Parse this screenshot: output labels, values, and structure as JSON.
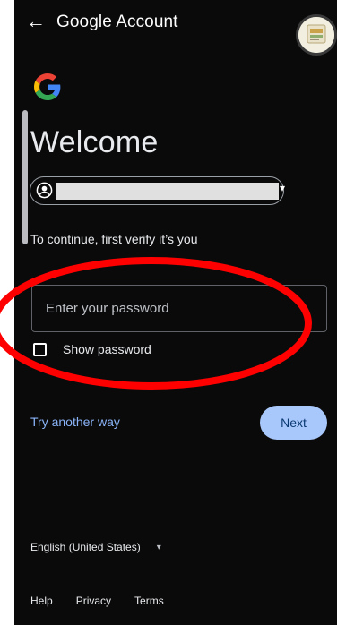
{
  "header": {
    "title_brand": "Google",
    "title_rest": " Account",
    "back_icon": "arrow-left-icon"
  },
  "main": {
    "heading": "Welcome",
    "verify_text": "To continue, first verify it’s you",
    "password_placeholder": "Enter your password",
    "show_password_label": "Show password",
    "show_password_checked": false,
    "try_another_way": "Try another way",
    "next_button": "Next"
  },
  "footer": {
    "language": "English (United States)",
    "links": [
      "Help",
      "Privacy",
      "Terms"
    ]
  },
  "colors": {
    "background": "#0a0a0a",
    "link": "#8ab4f8",
    "primary_button": "#a8c7fa",
    "annotation": "#ff0000"
  }
}
